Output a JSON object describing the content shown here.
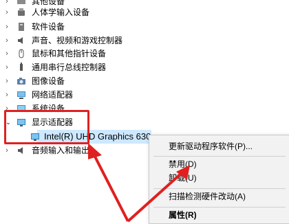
{
  "tree": {
    "items": [
      {
        "label": "其他设备",
        "icon": "unknown-device-icon",
        "expanded": false
      },
      {
        "label": "人体学输入设备",
        "icon": "hid-icon",
        "expanded": false
      },
      {
        "label": "软件设备",
        "icon": "software-device-icon",
        "expanded": false
      },
      {
        "label": "声音、视频和游戏控制器",
        "icon": "speaker-icon",
        "expanded": false
      },
      {
        "label": "鼠标和其他指针设备",
        "icon": "mouse-icon",
        "expanded": false
      },
      {
        "label": "通用串行总线控制器",
        "icon": "usb-icon",
        "expanded": false
      },
      {
        "label": "图像设备",
        "icon": "camera-icon",
        "expanded": false
      },
      {
        "label": "网络适配器",
        "icon": "network-adapter-icon",
        "expanded": false
      },
      {
        "label": "系统设备",
        "icon": "system-device-icon",
        "expanded": false
      },
      {
        "label": "显示适配器",
        "icon": "display-adapter-icon",
        "expanded": true
      },
      {
        "label": "音频输入和输出",
        "icon": "audio-io-icon",
        "expanded": false
      }
    ],
    "child": {
      "label": "Intel(R) UHD Graphics 630",
      "icon": "display-adapter-icon"
    }
  },
  "context_menu": {
    "items": [
      {
        "label": "更新驱动程序软件(P)..."
      },
      {
        "label": "禁用(D)"
      },
      {
        "label": "卸载(U)"
      },
      {
        "label": "扫描检测硬件改动(A)"
      },
      {
        "label": "属性(R)"
      }
    ]
  },
  "colors": {
    "annotation": "#e02020",
    "selection": "#cde8ff",
    "menu_bg": "#f2f2f2"
  }
}
